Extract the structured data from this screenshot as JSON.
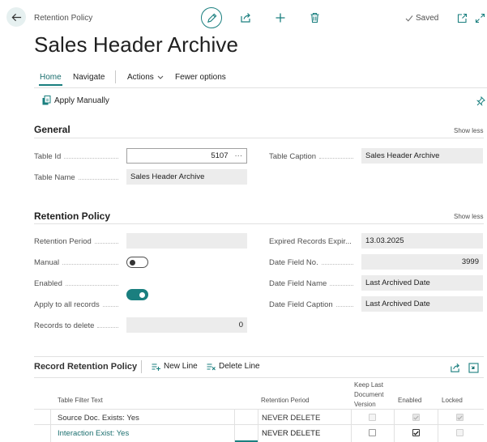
{
  "header": {
    "breadcrumb": "Retention Policy",
    "saved_label": "Saved",
    "title": "Sales Header Archive"
  },
  "icons": {
    "back": "back-arrow-icon",
    "edit": "pencil-icon",
    "share": "share-icon",
    "new": "plus-icon",
    "delete": "trash-icon",
    "open_new_window": "open-new-window-icon",
    "expand": "expand-icon",
    "pin": "pin-icon"
  },
  "actions": {
    "tabs": [
      "Home",
      "Navigate",
      "Actions",
      "Fewer options"
    ],
    "apply_manually": "Apply Manually"
  },
  "general": {
    "title": "General",
    "show_less": "Show less",
    "table_id_label": "Table Id",
    "table_id_value": "5107",
    "table_name_label": "Table Name",
    "table_name_value": "Sales Header Archive",
    "table_caption_label": "Table Caption",
    "table_caption_value": "Sales Header Archive"
  },
  "retention": {
    "title": "Retention Policy",
    "show_less": "Show less",
    "retention_period_label": "Retention Period",
    "retention_period_value": "",
    "manual_label": "Manual",
    "manual_on": false,
    "enabled_label": "Enabled",
    "enabled_on": true,
    "apply_all_label": "Apply to all records",
    "apply_all_on": false,
    "records_to_delete_label": "Records to delete",
    "records_to_delete_value": "0",
    "expired_label": "Expired Records Expir...",
    "expired_value": "13.03.2025",
    "date_field_no_label": "Date Field No.",
    "date_field_no_value": "3999",
    "date_field_name_label": "Date Field Name",
    "date_field_name_value": "Last Archived Date",
    "date_field_caption_label": "Date Field Caption",
    "date_field_caption_value": "Last Archived Date"
  },
  "subpage": {
    "title": "Record Retention Policy",
    "new_line": "New Line",
    "delete_line": "Delete Line",
    "columns": {
      "filter": "Table Filter Text",
      "period": "Retention Period",
      "keep_last": [
        "Keep Last",
        "Document",
        "Version"
      ],
      "enabled": "Enabled",
      "locked": "Locked"
    },
    "rows": [
      {
        "filter": "Source Doc. Exists: Yes",
        "period": "NEVER DELETE",
        "keep_last": false,
        "enabled": true,
        "locked": true,
        "readonly": true
      },
      {
        "filter": "Interaction Exist: Yes",
        "period": "NEVER DELETE",
        "keep_last": false,
        "enabled": true,
        "locked": false,
        "readonly": false
      }
    ]
  },
  "colors": {
    "accent": "#1a7f7f",
    "link": "#1a6e6e",
    "field_bg": "#ececec"
  }
}
